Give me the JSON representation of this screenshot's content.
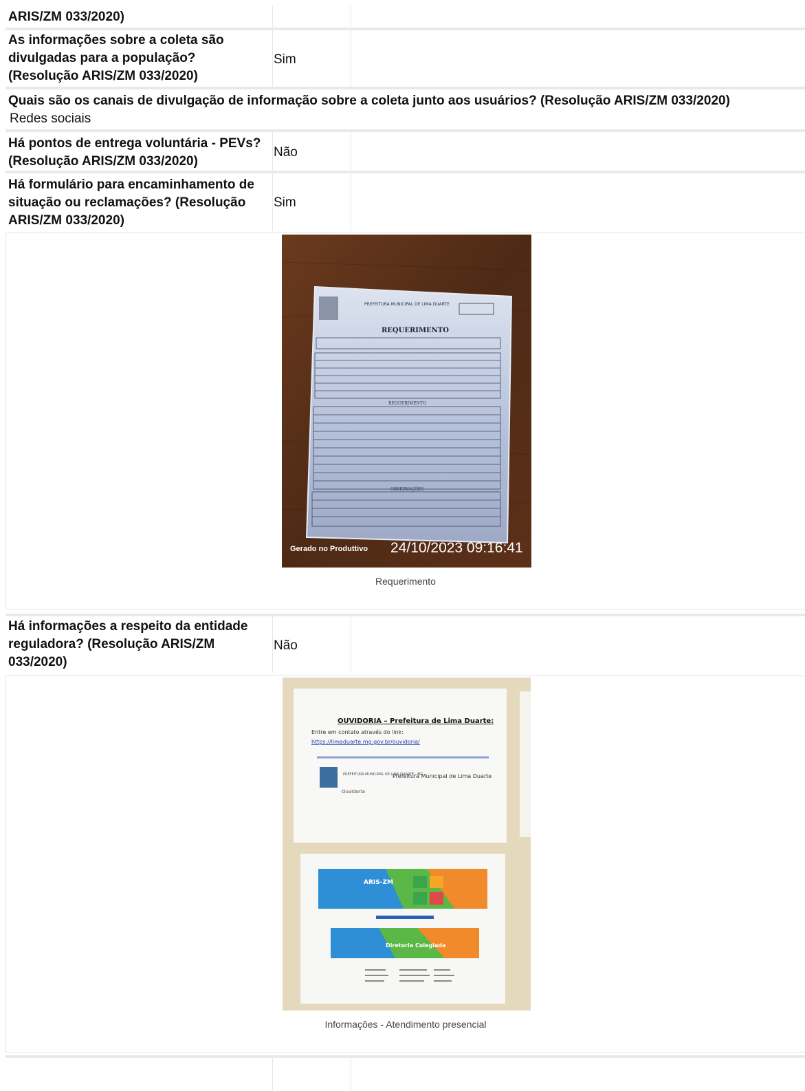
{
  "rows": [
    {
      "q": "ARIS/ZM 033/2020)",
      "a": ""
    },
    {
      "q": "As informações sobre a coleta são divulgadas para a população? (Resolução ARIS/ZM 033/2020)",
      "a": "Sim"
    },
    {
      "q": "Quais são os canais de divulgação de informação sobre a coleta junto aos usuários? (Resolução ARIS/ZM 033/2020)",
      "a": "Redes sociais"
    },
    {
      "q": "Há pontos de entrega voluntária - PEVs? (Resolução ARIS/ZM 033/2020)",
      "a": "Não"
    },
    {
      "q": "Há formulário para encaminhamento de situação ou reclamações? (Resolução ARIS/ZM 033/2020)",
      "a": "Sim"
    },
    {
      "q": "Há informações a respeito da entidade reguladora? (Resolução ARIS/ZM 033/2020)",
      "a": "Não"
    }
  ],
  "photo1": {
    "caption": "Requerimento",
    "form_header": "PREFEITURA MUNICIPAL DE LIMA DUARTE",
    "form_title": "REQUERIMENTO",
    "form_section": "REQUERIMENTO",
    "form_obs": "OBSERVAÇÕES",
    "watermark": "Gerado no Produttivo",
    "timestamp": "24/10/2023 09:16:41"
  },
  "photo2": {
    "caption": "Informações - Atendimento presencial",
    "poster_title": "OUVIDORIA – Prefeitura de Lima Duarte:",
    "poster_line": "Entre em contato através do link:",
    "poster_link": "https://limaduarte.mg.gov.br/ouvidoria/",
    "poster_logo_text": "PREFEITURA MUNICIPAL DE LIMA DUARTE - MG",
    "poster_site_name": "Prefeitura Municipal de Lima Duarte",
    "poster_section": "Ouvidoria",
    "screen_brand": "ARIS-ZM",
    "screen_banner": "Diretoria Colegiada"
  },
  "colors": {
    "border": "#e9e9e9",
    "wood": "#5a3119",
    "wall": "#e6dcc0",
    "paper_blue": "#c9d3e6"
  }
}
